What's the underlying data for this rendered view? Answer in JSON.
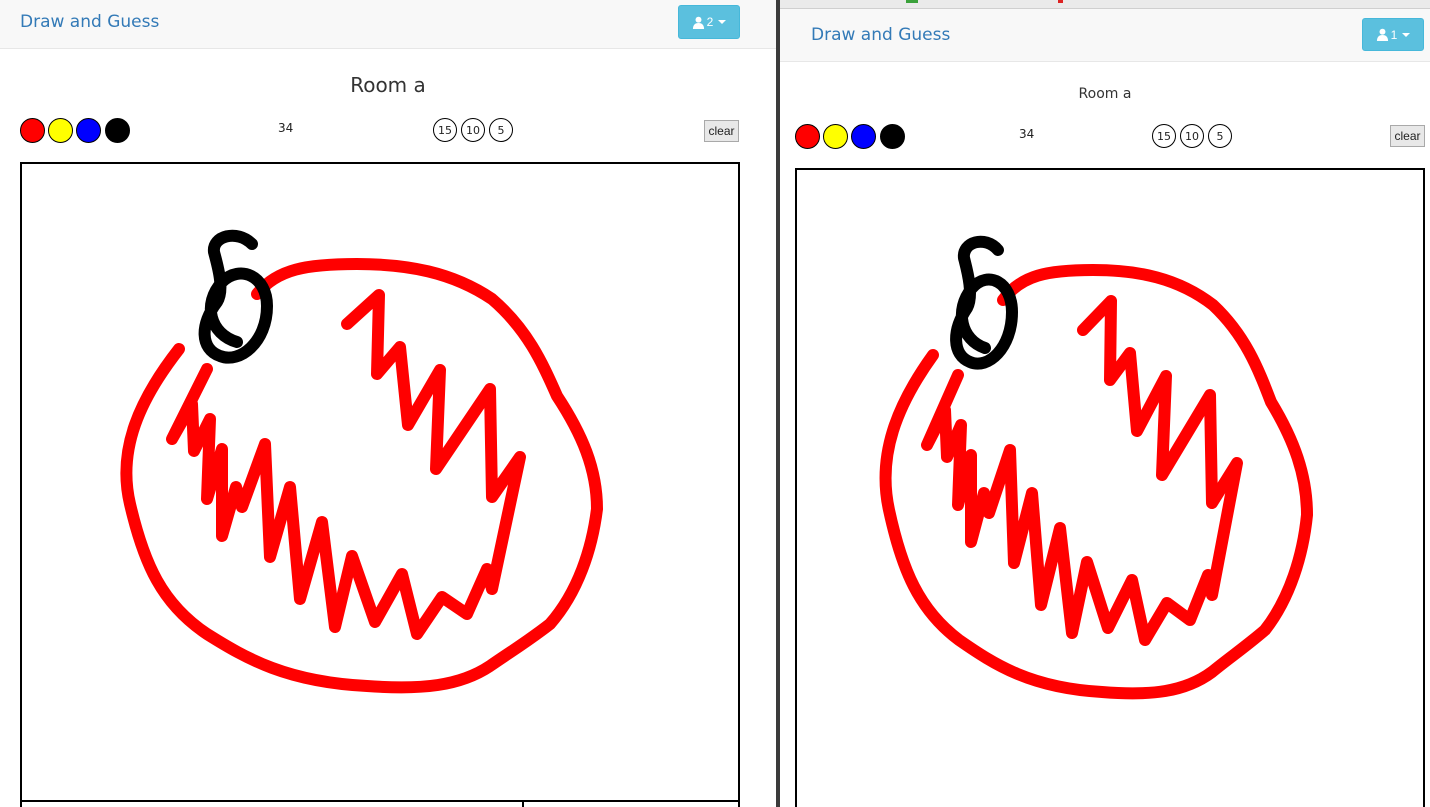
{
  "left": {
    "brand": "Draw and Guess",
    "user_count": "2",
    "room_title": "Room a",
    "counter": "34",
    "sizes": [
      "15",
      "10",
      "5"
    ],
    "clear_label": "clear"
  },
  "right": {
    "brand": "Draw and Guess",
    "user_count": "1",
    "room_title": "Room a",
    "counter": "34",
    "sizes": [
      "15",
      "10",
      "5"
    ],
    "clear_label": "clear"
  },
  "palette": [
    {
      "name": "red",
      "hex": "#ff0000"
    },
    {
      "name": "yellow",
      "hex": "#ffff00"
    },
    {
      "name": "blue",
      "hex": "#0000ff"
    },
    {
      "name": "black",
      "hex": "#000000"
    }
  ],
  "colors": {
    "brand": "#337ab7",
    "button": "#5bc0de",
    "stroke_red": "#ff0000",
    "stroke_black": "#000000"
  },
  "icons": {
    "user": "user-icon",
    "caret": "caret-down-icon"
  }
}
